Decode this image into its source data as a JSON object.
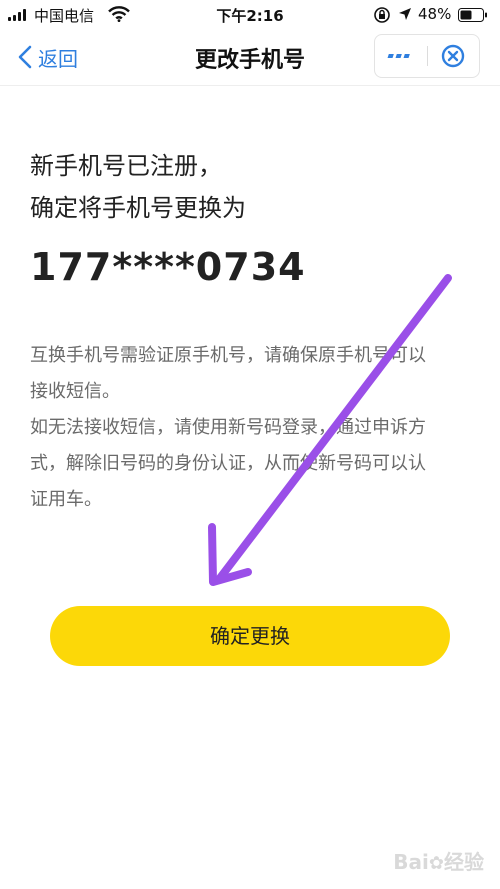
{
  "status_bar": {
    "carrier": "中国电信",
    "time": "下午2:16",
    "battery": "48%"
  },
  "nav": {
    "back_label": "返回",
    "title": "更改手机号"
  },
  "content": {
    "headline_line1": "新手机号已注册，",
    "headline_line2": "确定将手机号更换为",
    "phone_number": "177****0734",
    "desc_lines": [
      "互换手机号需验证原手机号，请确保原手机号可以",
      "接收短信。",
      "如无法接收短信，请使用新号码登录，通过申诉方",
      "式，解除旧号码的身份认证，从而使新号码可以认",
      "证用车。"
    ]
  },
  "confirm_button": {
    "label": "确定更换"
  },
  "annotation": {
    "arrow_color": "#9a4fe8"
  },
  "colors": {
    "accent_blue": "#2f7fdf",
    "button_yellow": "#fcd808"
  },
  "watermark": "Bai经验"
}
